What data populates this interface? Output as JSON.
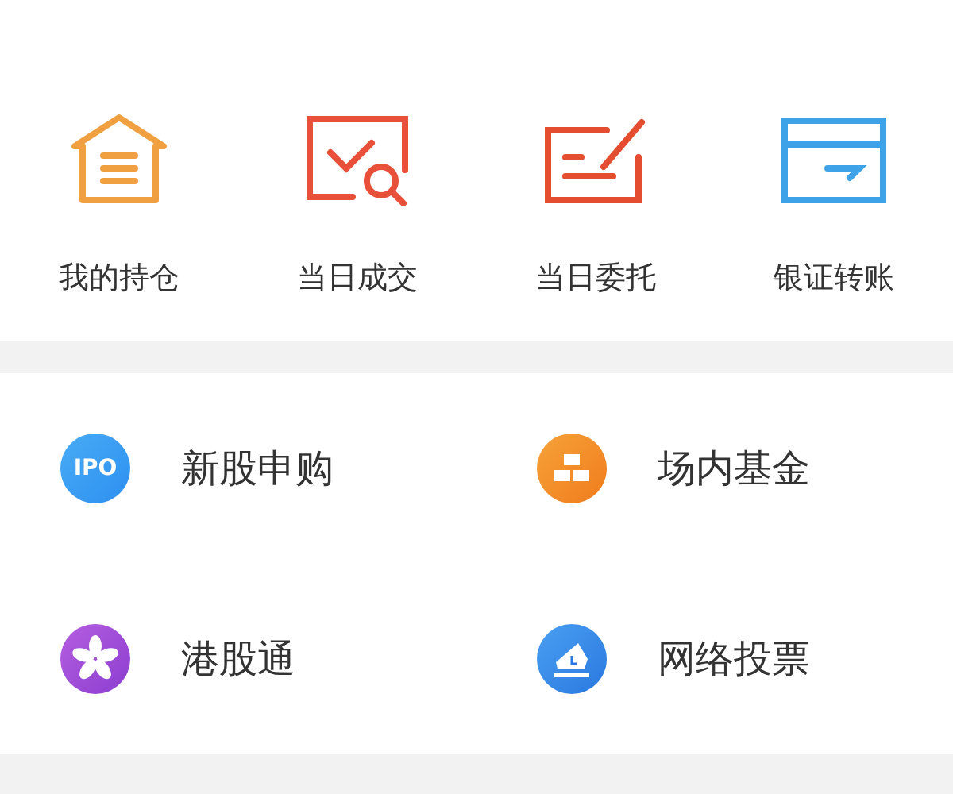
{
  "quick_actions": [
    {
      "kind": "house",
      "label": "我的持仓"
    },
    {
      "kind": "check-search",
      "label": "当日成交"
    },
    {
      "kind": "edit",
      "label": "当日委托"
    },
    {
      "kind": "card",
      "label": "银证转账"
    }
  ],
  "services": [
    {
      "kind": "ipo",
      "icon_text": "IPO",
      "label": "新股申购"
    },
    {
      "kind": "gold",
      "label": "场内基金"
    },
    {
      "kind": "flower",
      "label": "港股通"
    },
    {
      "kind": "vote",
      "label": "网络投票"
    }
  ]
}
